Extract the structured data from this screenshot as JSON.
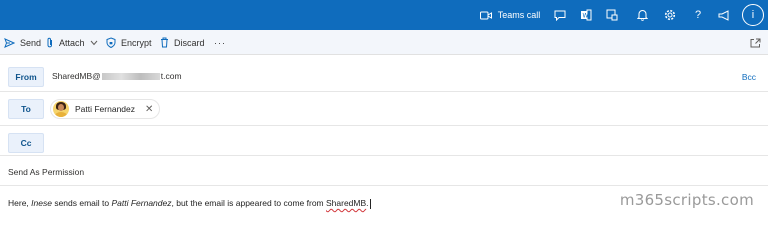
{
  "topbar": {
    "teams_call_label": "Teams call",
    "icons": [
      "video-camera-icon",
      "chat-icon",
      "office-icon",
      "sticky-note-icon",
      "bell-icon",
      "gear-icon",
      "help-icon",
      "megaphone-icon"
    ],
    "avatar_initial": "i",
    "bg_color": "#0f6cbd"
  },
  "toolbar": {
    "send_label": "Send",
    "attach_label": "Attach",
    "encrypt_label": "Encrypt",
    "discard_label": "Discard",
    "more_label": "···"
  },
  "from": {
    "button_label": "From",
    "address_prefix": "SharedMB@",
    "address_suffix": "t.com",
    "bcc_label": "Bcc"
  },
  "to": {
    "button_label": "To",
    "recipient_name": "Patti Fernandez",
    "remove_glyph": "✕"
  },
  "cc": {
    "button_label": "Cc"
  },
  "subject": {
    "value": "Send As Permission"
  },
  "body": {
    "part1": "Here, ",
    "name1": "Inese",
    "part2": " sends email to ",
    "name2": "Patti Fernandez",
    "part3": ", but the email is appeared to come from ",
    "shared": "SharedMB",
    "part4": "."
  },
  "watermark": "m365scripts.com"
}
